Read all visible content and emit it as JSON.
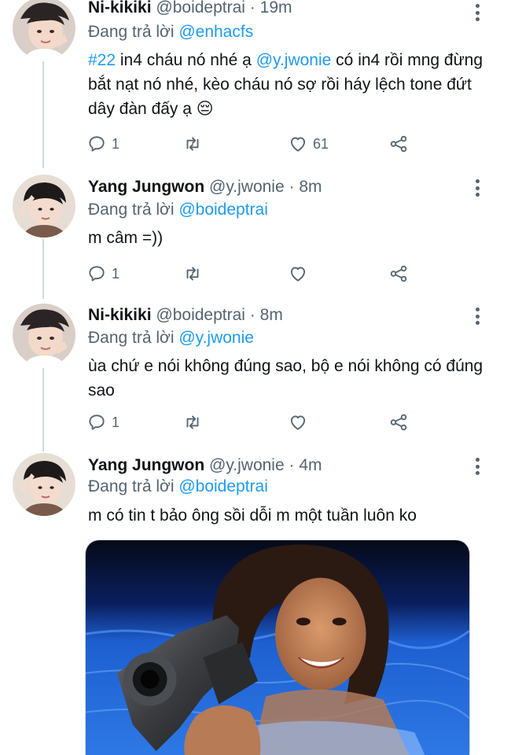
{
  "tweets": [
    {
      "name": "Ni-kikiki",
      "handle": "@boideptrai",
      "dot": "·",
      "time": "19m",
      "reply_prefix": "Đang trả lời ",
      "reply_to": "@enhacfs",
      "text": {
        "hashtag": "#22",
        "part1": " in4 cháu nó nhé ạ ",
        "mention": "@y.jwonie",
        "part2": " có in4 rồi mng đừng bắt nạt nó nhé, kèo cháu nó sợ rồi háy lệch tone đứt dây đàn đấy ạ ",
        "emoji": "😔"
      },
      "stats": {
        "replies": "1",
        "retweets": "",
        "likes": "61"
      }
    },
    {
      "name": "Yang Jungwon",
      "handle": "@y.jwonie",
      "dot": "·",
      "time": "8m",
      "reply_prefix": "Đang trả lời ",
      "reply_to": "@boideptrai",
      "text": "m câm =))",
      "stats": {
        "replies": "1",
        "retweets": "",
        "likes": ""
      }
    },
    {
      "name": "Ni-kikiki",
      "handle": "@boideptrai",
      "dot": "·",
      "time": "8m",
      "reply_prefix": "Đang trả lời ",
      "reply_to": "@y.jwonie",
      "text": "ùa chứ e nói không đúng sao, bộ e nói không có đúng sao",
      "stats": {
        "replies": "1",
        "retweets": "",
        "likes": ""
      }
    },
    {
      "name": "Yang Jungwon",
      "handle": "@y.jwonie",
      "dot": "·",
      "time": "4m",
      "reply_prefix": "Đang trả lời ",
      "reply_to": "@boideptrai",
      "text": "m có tin t bảo ông sồi dỗi m một tuần luôn ko"
    }
  ],
  "icons": {
    "reply": "reply-icon",
    "retweet": "retweet-icon",
    "like": "heart-icon",
    "share": "share-icon",
    "more": "more-vertical-icon"
  },
  "colors": {
    "link": "#1d9bf0",
    "secondary_text": "#536471",
    "primary_text": "#0f1419",
    "thread_line": "#cfd9de"
  }
}
